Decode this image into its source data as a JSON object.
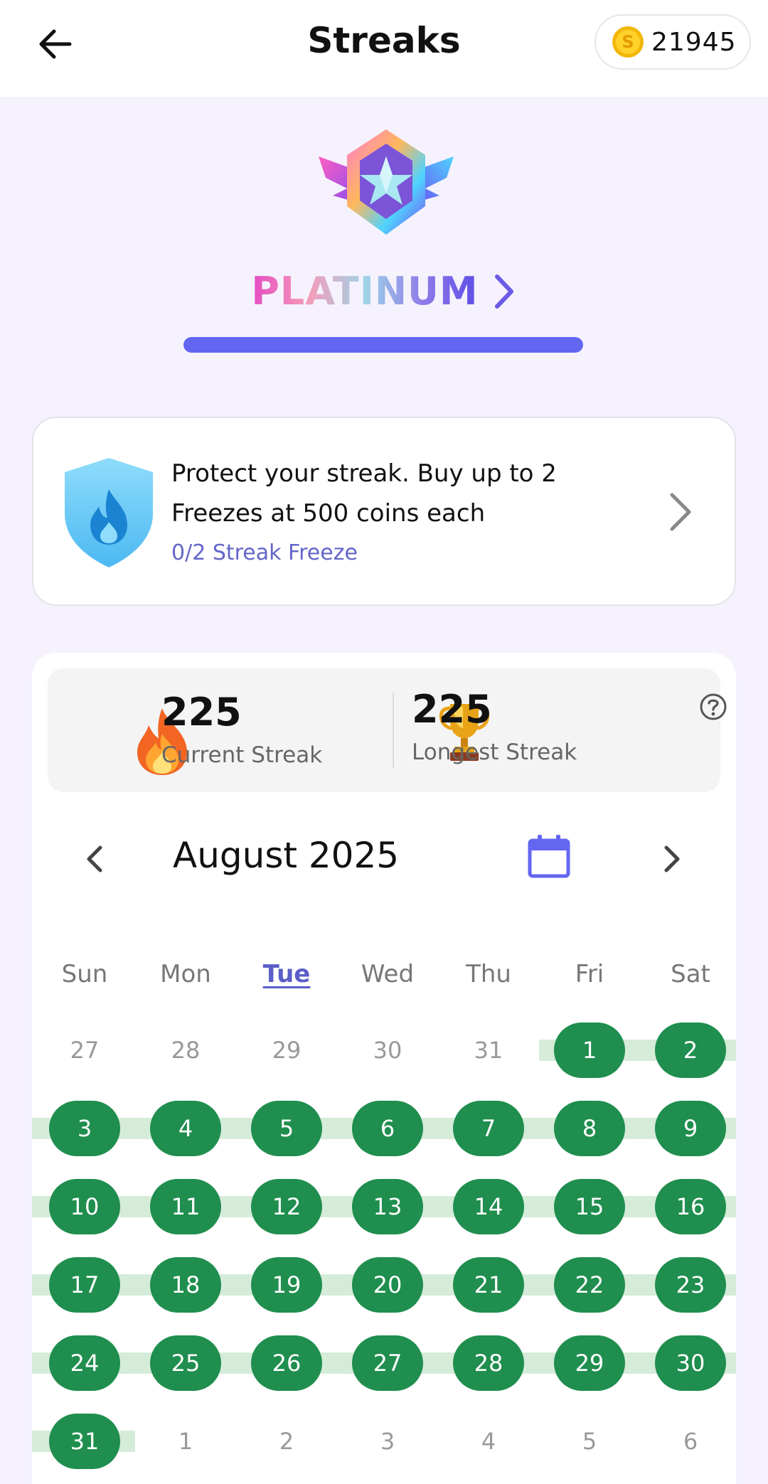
{
  "header": {
    "title": "Streaks",
    "coins": "21945"
  },
  "tier": {
    "name": "PLATINUM",
    "progress": 1.0
  },
  "freeze_card": {
    "message": "Protect your streak. Buy up to 2 Freezes at 500 coins each",
    "status": "0/2 Streak Freeze"
  },
  "stats": {
    "current_value": "225",
    "current_label": "Current Streak",
    "longest_value": "225",
    "longest_label": "Longest Streak"
  },
  "calendar": {
    "month_label": "August 2025",
    "weekdays": [
      "Sun",
      "Mon",
      "Tue",
      "Wed",
      "Thu",
      "Fri",
      "Sat"
    ],
    "today_weekday_index": 2,
    "weeks": [
      [
        {
          "d": "27",
          "s": false
        },
        {
          "d": "28",
          "s": false
        },
        {
          "d": "29",
          "s": false
        },
        {
          "d": "30",
          "s": false
        },
        {
          "d": "31",
          "s": false
        },
        {
          "d": "1",
          "s": true
        },
        {
          "d": "2",
          "s": true
        }
      ],
      [
        {
          "d": "3",
          "s": true
        },
        {
          "d": "4",
          "s": true
        },
        {
          "d": "5",
          "s": true
        },
        {
          "d": "6",
          "s": true
        },
        {
          "d": "7",
          "s": true
        },
        {
          "d": "8",
          "s": true
        },
        {
          "d": "9",
          "s": true
        }
      ],
      [
        {
          "d": "10",
          "s": true
        },
        {
          "d": "11",
          "s": true
        },
        {
          "d": "12",
          "s": true
        },
        {
          "d": "13",
          "s": true
        },
        {
          "d": "14",
          "s": true
        },
        {
          "d": "15",
          "s": true
        },
        {
          "d": "16",
          "s": true
        }
      ],
      [
        {
          "d": "17",
          "s": true
        },
        {
          "d": "18",
          "s": true
        },
        {
          "d": "19",
          "s": true
        },
        {
          "d": "20",
          "s": true
        },
        {
          "d": "21",
          "s": true
        },
        {
          "d": "22",
          "s": true
        },
        {
          "d": "23",
          "s": true
        }
      ],
      [
        {
          "d": "24",
          "s": true
        },
        {
          "d": "25",
          "s": true
        },
        {
          "d": "26",
          "s": true
        },
        {
          "d": "27",
          "s": true
        },
        {
          "d": "28",
          "s": true
        },
        {
          "d": "29",
          "s": true
        },
        {
          "d": "30",
          "s": true
        }
      ],
      [
        {
          "d": "31",
          "s": true
        },
        {
          "d": "1",
          "s": false
        },
        {
          "d": "2",
          "s": false
        },
        {
          "d": "3",
          "s": false
        },
        {
          "d": "4",
          "s": false
        },
        {
          "d": "5",
          "s": false
        },
        {
          "d": "6",
          "s": false
        }
      ]
    ]
  },
  "colors": {
    "accent": "#6366f1",
    "streak_green": "#1f8e4e",
    "streak_band": "#d5ecd9"
  }
}
